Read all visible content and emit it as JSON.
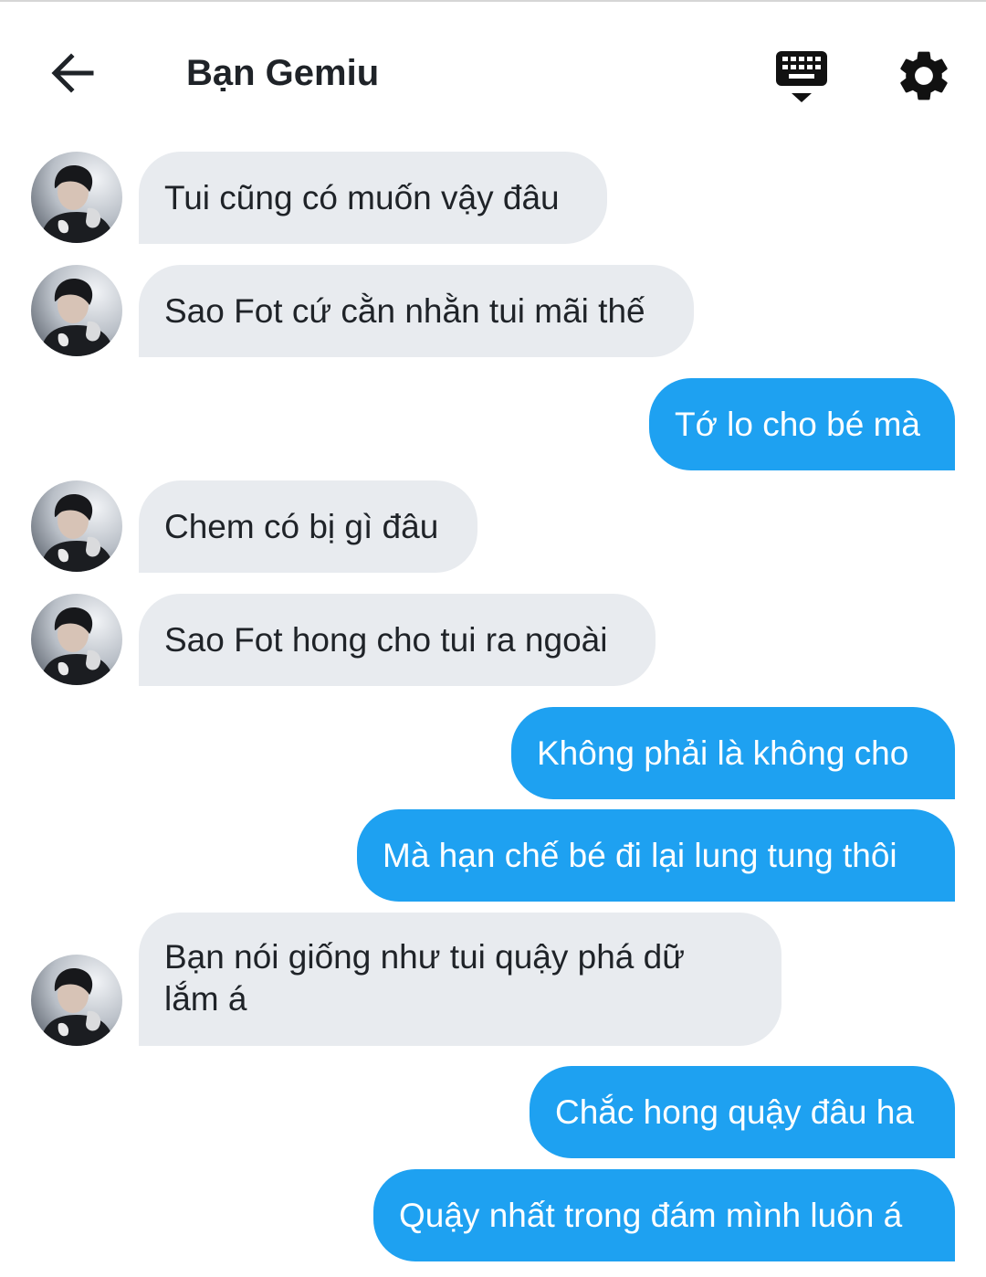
{
  "header": {
    "title": "Bạn Gemiu",
    "back_icon": "arrow-left-icon",
    "keyboard_icon": "keyboard-hide-icon",
    "settings_icon": "gear-icon"
  },
  "colors": {
    "incoming_bubble": "#e8ebef",
    "outgoing_bubble": "#1ea1f1",
    "text_dark": "#1f2328",
    "text_light": "#ffffff"
  },
  "messages": [
    {
      "side": "in",
      "text": "Tui cũng có muốn vậy đâu"
    },
    {
      "side": "in",
      "text": "Sao Fot cứ cằn nhằn tui mãi thế"
    },
    {
      "side": "out",
      "text": "Tớ lo cho bé mà"
    },
    {
      "side": "in",
      "text": "Chem có bị gì đâu"
    },
    {
      "side": "in",
      "text": "Sao Fot hong cho tui ra ngoài"
    },
    {
      "side": "out",
      "text": "Không phải là không cho"
    },
    {
      "side": "out",
      "text": "Mà hạn chế bé đi lại lung tung thôi"
    },
    {
      "side": "in",
      "text": "Bạn nói giống như tui quậy phá dữ lắm á"
    },
    {
      "side": "out",
      "text": "Chắc hong quậy đâu ha"
    },
    {
      "side": "out",
      "text": "Quậy nhất trong đám mình luôn á"
    }
  ]
}
